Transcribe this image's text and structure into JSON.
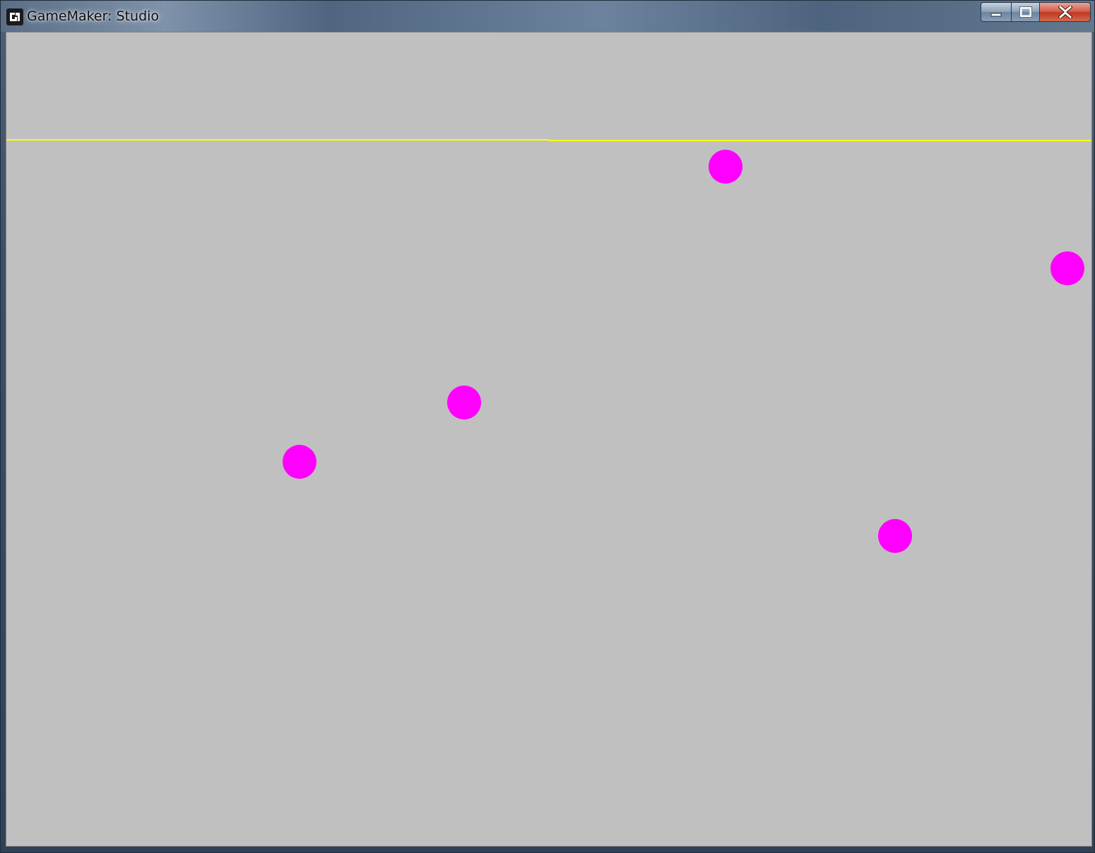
{
  "window": {
    "title": "GameMaker: Studio",
    "icon": "gamemaker-logo-icon",
    "controls": {
      "minimize_icon": "minimize-icon",
      "maximize_icon": "maximize-icon",
      "close_icon": "close-icon"
    }
  },
  "game": {
    "background_color": "#c0c0c0",
    "line_color": "#ffff00",
    "ball_color": "#ff00ff",
    "ball_count": 5
  }
}
